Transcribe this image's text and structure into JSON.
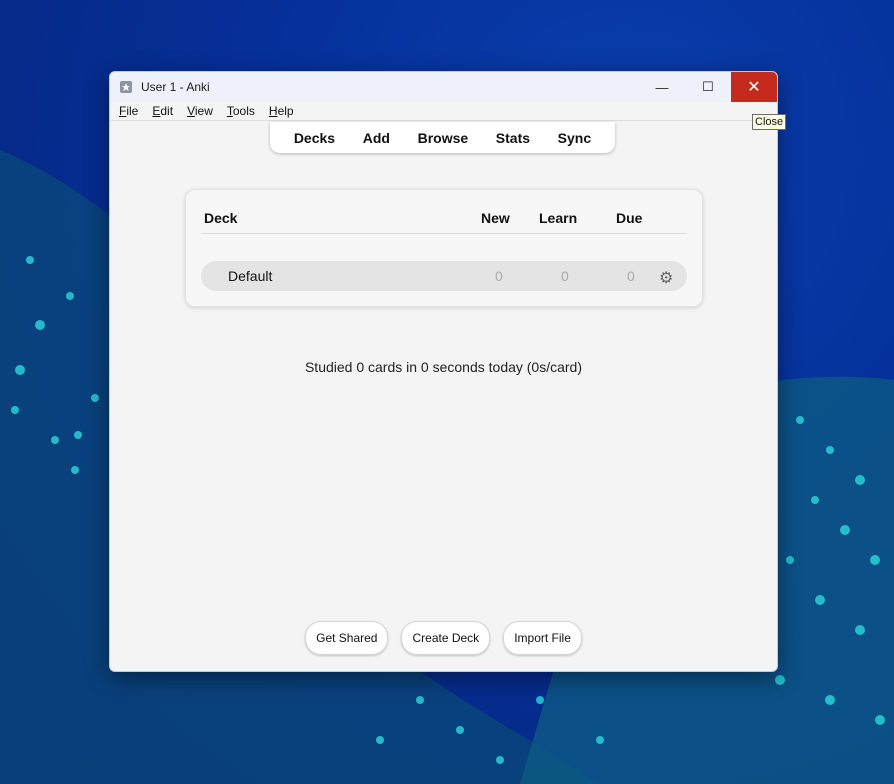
{
  "window": {
    "title": "User 1 - Anki"
  },
  "window_controls": {
    "minimize": "—",
    "maximize": "☐",
    "close": "✕"
  },
  "tooltip": "Close",
  "menu": [
    "File",
    "Edit",
    "View",
    "Tools",
    "Help"
  ],
  "toolbar": [
    "Decks",
    "Add",
    "Browse",
    "Stats",
    "Sync"
  ],
  "deck_table": {
    "headers": {
      "deck": "Deck",
      "new": "New",
      "learn": "Learn",
      "due": "Due"
    },
    "rows": [
      {
        "name": "Default",
        "new": "0",
        "learn": "0",
        "due": "0"
      }
    ]
  },
  "studied": "Studied 0 cards in 0 seconds today (0s/card)",
  "buttons": {
    "get_shared": "Get Shared",
    "create_deck": "Create Deck",
    "import_file": "Import File"
  }
}
